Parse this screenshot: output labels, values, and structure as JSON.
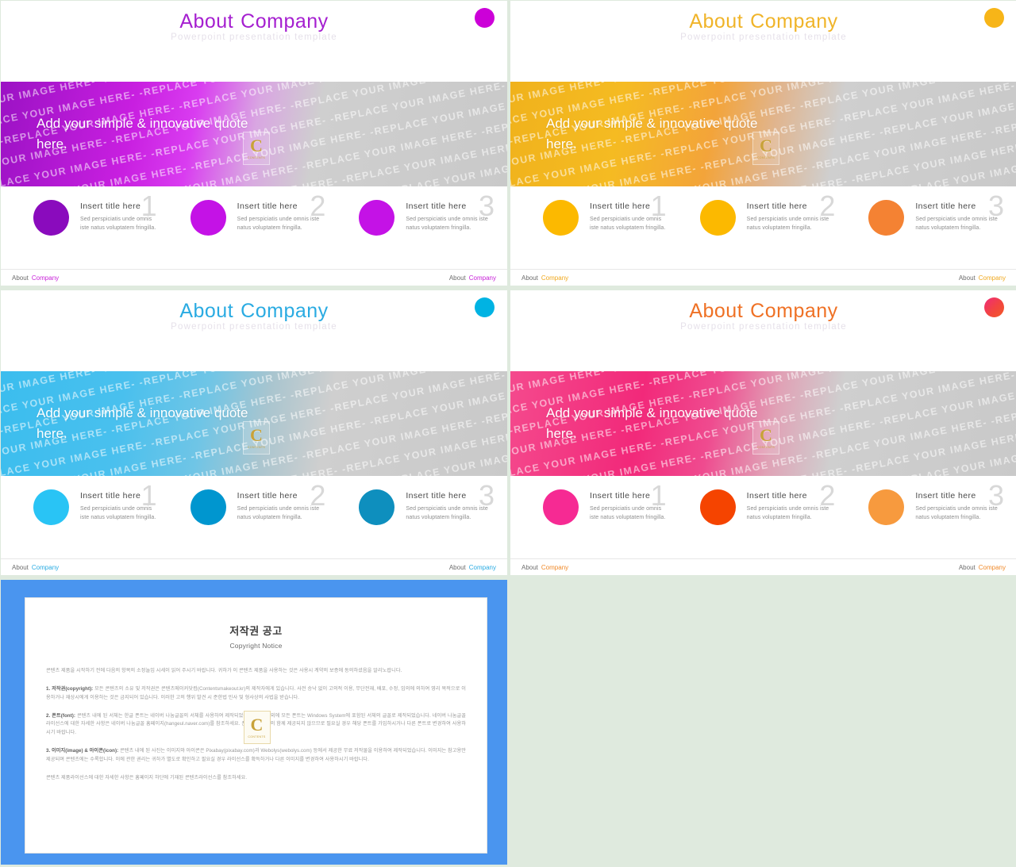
{
  "page": {
    "background_color": "#dfeade"
  },
  "common": {
    "header_title_word1": "About",
    "header_title_word2": "Company",
    "header_subtitle": "Powerpoint presentation template",
    "quote_text": "Add your simple & innovative quote here.",
    "watermark_text": "-REPLACE YOUR IMAGE HERE-   -REPLACE YOUR IMAGE HERE-   -REPLACE YOUR IMAGE HERE-   -REPLACE YOUR IMAGE HERE-",
    "badge_letter": "C",
    "badge_caption": "CONTENTS",
    "footer_left_a": "About",
    "footer_left_b": "Company",
    "footer_right_a": "About",
    "footer_right_b": "Company",
    "card_title": "Insert title here",
    "card_desc": "Sed perspiciatis unde omnis iste natus voluptatem fringilla.",
    "card_numbers": [
      "1",
      "2",
      "3"
    ]
  },
  "slides": [
    {
      "name": "purple",
      "accent": "#b000d0",
      "dot_color": "#cc00d8",
      "title_color": "#a51fd0",
      "footer_accent": "#c71fd8",
      "band_gradient": "linear-gradient(100deg, #9b12c4 0%, #c81fe0 26%, #d93cf0 38%, #d9a6e2 50%, #cfcfcf 62%, #c9c9c9 100%)",
      "circles": [
        "#8a0bbd",
        "#c412e6",
        "#c412e6"
      ]
    },
    {
      "name": "yellow-orange",
      "accent": "#f5a623",
      "dot_color": "#f7b518",
      "title_color": "#f0b429",
      "footer_accent": "#f0a81e",
      "band_gradient": "linear-gradient(100deg, #f0b21c 0%, #f5bb22 22%, #f3a43a 40%, #e0b58f 52%, #cfcfcf 64%, #c9c9c9 100%)",
      "circles": [
        "#fcb900",
        "#fcb900",
        "#f48233"
      ]
    },
    {
      "name": "blue",
      "accent": "#28a9e0",
      "dot_color": "#00b3e3",
      "title_color": "#2aabe2",
      "footer_accent": "#2aabe2",
      "band_gradient": "linear-gradient(100deg, #3bbdee 0%, #49c0ee 24%, #6fc5e6 40%, #a9c5cf 52%, #cfcfcf 64%, #c9c9c9 100%)",
      "circles": [
        "#29c4f5",
        "#0096cf",
        "#0e8fbe"
      ]
    },
    {
      "name": "pink-red",
      "accent": "#f0256f",
      "dot_color": "#f2385a",
      "title_color": "#ef7125",
      "footer_accent": "#f08a2a",
      "band_gradient": "linear-gradient(100deg, #f44a8d 0%, #f2297a 26%, #ef4b8f 40%, #e0a2b6 52%, #cfcfcf 64%, #c9c9c9 100%)",
      "circles": [
        "#f62a93",
        "#f54400",
        "#f79a3e"
      ]
    }
  ],
  "copyright_slide": {
    "background_color": "#4a95ef",
    "title": "저작권 공고",
    "subtitle": "Copyright Notice",
    "badge_letter": "C",
    "badge_caption": "CONTENTS",
    "paragraphs": [
      {
        "lead": "",
        "text": "콘텐츠 제품을 시작하기 전에 다음의 항목의 소정놀입 시세이 읽어 주시기 바랍니다. 귀하가 이 콘텐츠 제품을 사용하는 것은 사용시 계약의 보증에 동의하셨음을 알리노랍니다."
      },
      {
        "lead": "1. 저작권(copyright):",
        "text": " 모든 콘텐츠의 소유 및 저작권은 콘텐츠메이커닷컴(Contentsmakeout.kr)의 제작자에게 있습니다. 사전 승낙 없이 고의적 이용, 무단전재, 배포, 수정, 임의에 의하여 영리 목적으로 이용하거나 재상시에게 이용하는 것은 금지되어 있습니다. 이러한 고의 행위 발견 시 준한법 민사 및 형사상의 사법을 받습니다."
      },
      {
        "lead": "2. 폰트(font):",
        "text": " 콘텐츠 내에 된 서체는 한글 폰트는 네이버 나눔글꼴의 서체를 사용하여 제작되었습니다. 한글 외에 모든 폰트는 Windows System에 포함된 서체의 글꼴로 제작되었습니다. 네이버 나눔글꼴 라이선스에 대한 자세한 사항은 네이버 나눔글꼴 홈페이지(hangeul.naver.com)를 참조하세요. 폰트는 콘텐츠의 함께 제공되지 않으므로 필요실 경우 해당 폰트를 가입하시거나 다른 폰트로 변경하여 사용하시기 바랍니다."
      },
      {
        "lead": "3. 이미지(image) & 아이콘(icon):",
        "text": " 콘텐츠 내에 된 사진는 이미지와 아이콘은 Pixabay(pixabay.com)과 Webolys(webolys.com) 등에서 제공한 무료 저작물을 이용하여 제작되었습니다. 이미지는 참고용만 제공되며 콘텐츠에는 수록합니다. 이에 관한 권리는 귀하가 별도로 확인하고 필요실 경우 라이선스를 확득하거나 다른 이미지를 변경하여 사용하시기 바랍니다."
      },
      {
        "lead": "",
        "text": "콘텐츠 제품라이선스에 대한 자세한 사항은 홈페이지 하단에 기재된 콘텐츠라이선스를 참조하세요."
      }
    ]
  }
}
